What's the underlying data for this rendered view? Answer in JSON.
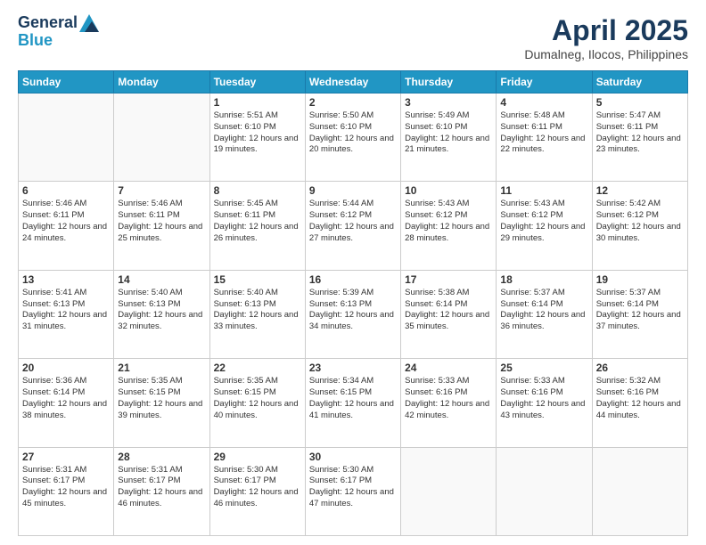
{
  "header": {
    "logo_line1": "General",
    "logo_line2": "Blue",
    "title": "April 2025",
    "subtitle": "Dumalneg, Ilocos, Philippines"
  },
  "days_of_week": [
    "Sunday",
    "Monday",
    "Tuesday",
    "Wednesday",
    "Thursday",
    "Friday",
    "Saturday"
  ],
  "weeks": [
    [
      {
        "day": "",
        "sunrise": "",
        "sunset": "",
        "daylight": ""
      },
      {
        "day": "",
        "sunrise": "",
        "sunset": "",
        "daylight": ""
      },
      {
        "day": "1",
        "sunrise": "Sunrise: 5:51 AM",
        "sunset": "Sunset: 6:10 PM",
        "daylight": "Daylight: 12 hours and 19 minutes."
      },
      {
        "day": "2",
        "sunrise": "Sunrise: 5:50 AM",
        "sunset": "Sunset: 6:10 PM",
        "daylight": "Daylight: 12 hours and 20 minutes."
      },
      {
        "day": "3",
        "sunrise": "Sunrise: 5:49 AM",
        "sunset": "Sunset: 6:10 PM",
        "daylight": "Daylight: 12 hours and 21 minutes."
      },
      {
        "day": "4",
        "sunrise": "Sunrise: 5:48 AM",
        "sunset": "Sunset: 6:11 PM",
        "daylight": "Daylight: 12 hours and 22 minutes."
      },
      {
        "day": "5",
        "sunrise": "Sunrise: 5:47 AM",
        "sunset": "Sunset: 6:11 PM",
        "daylight": "Daylight: 12 hours and 23 minutes."
      }
    ],
    [
      {
        "day": "6",
        "sunrise": "Sunrise: 5:46 AM",
        "sunset": "Sunset: 6:11 PM",
        "daylight": "Daylight: 12 hours and 24 minutes."
      },
      {
        "day": "7",
        "sunrise": "Sunrise: 5:46 AM",
        "sunset": "Sunset: 6:11 PM",
        "daylight": "Daylight: 12 hours and 25 minutes."
      },
      {
        "day": "8",
        "sunrise": "Sunrise: 5:45 AM",
        "sunset": "Sunset: 6:11 PM",
        "daylight": "Daylight: 12 hours and 26 minutes."
      },
      {
        "day": "9",
        "sunrise": "Sunrise: 5:44 AM",
        "sunset": "Sunset: 6:12 PM",
        "daylight": "Daylight: 12 hours and 27 minutes."
      },
      {
        "day": "10",
        "sunrise": "Sunrise: 5:43 AM",
        "sunset": "Sunset: 6:12 PM",
        "daylight": "Daylight: 12 hours and 28 minutes."
      },
      {
        "day": "11",
        "sunrise": "Sunrise: 5:43 AM",
        "sunset": "Sunset: 6:12 PM",
        "daylight": "Daylight: 12 hours and 29 minutes."
      },
      {
        "day": "12",
        "sunrise": "Sunrise: 5:42 AM",
        "sunset": "Sunset: 6:12 PM",
        "daylight": "Daylight: 12 hours and 30 minutes."
      }
    ],
    [
      {
        "day": "13",
        "sunrise": "Sunrise: 5:41 AM",
        "sunset": "Sunset: 6:13 PM",
        "daylight": "Daylight: 12 hours and 31 minutes."
      },
      {
        "day": "14",
        "sunrise": "Sunrise: 5:40 AM",
        "sunset": "Sunset: 6:13 PM",
        "daylight": "Daylight: 12 hours and 32 minutes."
      },
      {
        "day": "15",
        "sunrise": "Sunrise: 5:40 AM",
        "sunset": "Sunset: 6:13 PM",
        "daylight": "Daylight: 12 hours and 33 minutes."
      },
      {
        "day": "16",
        "sunrise": "Sunrise: 5:39 AM",
        "sunset": "Sunset: 6:13 PM",
        "daylight": "Daylight: 12 hours and 34 minutes."
      },
      {
        "day": "17",
        "sunrise": "Sunrise: 5:38 AM",
        "sunset": "Sunset: 6:14 PM",
        "daylight": "Daylight: 12 hours and 35 minutes."
      },
      {
        "day": "18",
        "sunrise": "Sunrise: 5:37 AM",
        "sunset": "Sunset: 6:14 PM",
        "daylight": "Daylight: 12 hours and 36 minutes."
      },
      {
        "day": "19",
        "sunrise": "Sunrise: 5:37 AM",
        "sunset": "Sunset: 6:14 PM",
        "daylight": "Daylight: 12 hours and 37 minutes."
      }
    ],
    [
      {
        "day": "20",
        "sunrise": "Sunrise: 5:36 AM",
        "sunset": "Sunset: 6:14 PM",
        "daylight": "Daylight: 12 hours and 38 minutes."
      },
      {
        "day": "21",
        "sunrise": "Sunrise: 5:35 AM",
        "sunset": "Sunset: 6:15 PM",
        "daylight": "Daylight: 12 hours and 39 minutes."
      },
      {
        "day": "22",
        "sunrise": "Sunrise: 5:35 AM",
        "sunset": "Sunset: 6:15 PM",
        "daylight": "Daylight: 12 hours and 40 minutes."
      },
      {
        "day": "23",
        "sunrise": "Sunrise: 5:34 AM",
        "sunset": "Sunset: 6:15 PM",
        "daylight": "Daylight: 12 hours and 41 minutes."
      },
      {
        "day": "24",
        "sunrise": "Sunrise: 5:33 AM",
        "sunset": "Sunset: 6:16 PM",
        "daylight": "Daylight: 12 hours and 42 minutes."
      },
      {
        "day": "25",
        "sunrise": "Sunrise: 5:33 AM",
        "sunset": "Sunset: 6:16 PM",
        "daylight": "Daylight: 12 hours and 43 minutes."
      },
      {
        "day": "26",
        "sunrise": "Sunrise: 5:32 AM",
        "sunset": "Sunset: 6:16 PM",
        "daylight": "Daylight: 12 hours and 44 minutes."
      }
    ],
    [
      {
        "day": "27",
        "sunrise": "Sunrise: 5:31 AM",
        "sunset": "Sunset: 6:17 PM",
        "daylight": "Daylight: 12 hours and 45 minutes."
      },
      {
        "day": "28",
        "sunrise": "Sunrise: 5:31 AM",
        "sunset": "Sunset: 6:17 PM",
        "daylight": "Daylight: 12 hours and 46 minutes."
      },
      {
        "day": "29",
        "sunrise": "Sunrise: 5:30 AM",
        "sunset": "Sunset: 6:17 PM",
        "daylight": "Daylight: 12 hours and 46 minutes."
      },
      {
        "day": "30",
        "sunrise": "Sunrise: 5:30 AM",
        "sunset": "Sunset: 6:17 PM",
        "daylight": "Daylight: 12 hours and 47 minutes."
      },
      {
        "day": "",
        "sunrise": "",
        "sunset": "",
        "daylight": ""
      },
      {
        "day": "",
        "sunrise": "",
        "sunset": "",
        "daylight": ""
      },
      {
        "day": "",
        "sunrise": "",
        "sunset": "",
        "daylight": ""
      }
    ]
  ]
}
